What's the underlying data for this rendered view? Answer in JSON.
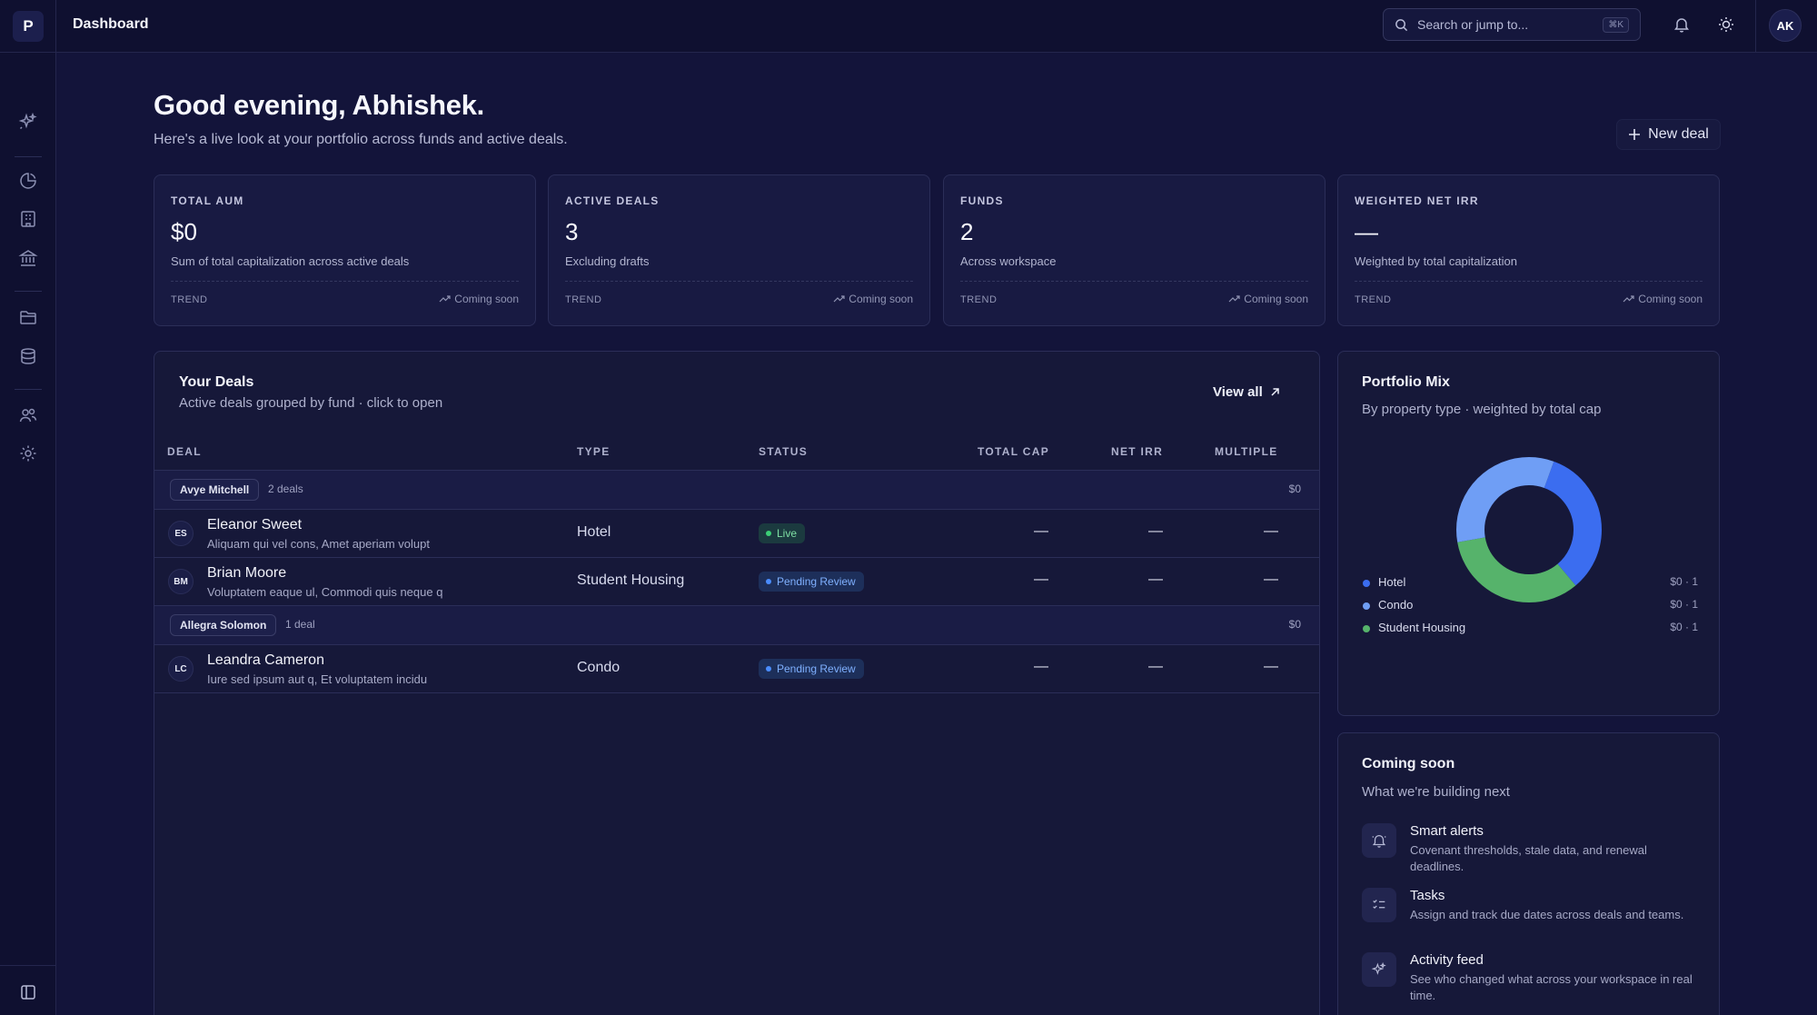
{
  "app": {
    "logo_letter": "P",
    "page_title": "Dashboard"
  },
  "search": {
    "placeholder": "Search or jump to...",
    "shortcut": "⌘K"
  },
  "user": {
    "initials": "AK"
  },
  "sidebar": {
    "icons": [
      "sparkle-icon",
      "pie-chart-icon",
      "building-icon",
      "bank-icon",
      "folder-icon",
      "database-icon",
      "users-icon",
      "gear-icon"
    ],
    "footer_icon": "sidebar-toggle-icon"
  },
  "header": {
    "greeting": "Good evening, Abhishek.",
    "subtitle": "Here's a live look at your portfolio across funds and active deals.",
    "new_deal_label": "New deal"
  },
  "kpis": [
    {
      "label": "TOTAL AUM",
      "value": "$0",
      "desc": "Sum of total capitalization across active deals",
      "trend_label": "TREND",
      "trend_value": "Coming soon"
    },
    {
      "label": "ACTIVE DEALS",
      "value": "3",
      "desc": "Excluding drafts",
      "trend_label": "TREND",
      "trend_value": "Coming soon"
    },
    {
      "label": "FUNDS",
      "value": "2",
      "desc": "Across workspace",
      "trend_label": "TREND",
      "trend_value": "Coming soon"
    },
    {
      "label": "WEIGHTED NET IRR",
      "value": "—",
      "desc": "Weighted by total capitalization",
      "trend_label": "TREND",
      "trend_value": "Coming soon"
    }
  ],
  "deals": {
    "title": "Your Deals",
    "subtitle": "Active deals grouped by fund · click to open",
    "view_all": "View all",
    "columns": [
      "DEAL",
      "TYPE",
      "STATUS",
      "TOTAL CAP",
      "NET IRR",
      "MULTIPLE"
    ],
    "groups": [
      {
        "fund": "Avye Mitchell",
        "count": "2 deals",
        "total": "$0",
        "rows": [
          {
            "initials": "ES",
            "name": "Eleanor Sweet",
            "desc": "Aliquam qui vel cons, Amet aperiam volupt",
            "type": "Hotel",
            "status": "Live",
            "total_cap": "—",
            "net_irr": "—",
            "multiple": "—"
          },
          {
            "initials": "BM",
            "name": "Brian Moore",
            "desc": "Voluptatem eaque ul, Commodi quis neque q",
            "type": "Student Housing",
            "status": "Pending Review",
            "total_cap": "—",
            "net_irr": "—",
            "multiple": "—"
          }
        ]
      },
      {
        "fund": "Allegra Solomon",
        "count": "1 deal",
        "total": "$0",
        "rows": [
          {
            "initials": "LC",
            "name": "Leandra Cameron",
            "desc": "Iure sed ipsum aut q, Et voluptatem incidu",
            "type": "Condo",
            "status": "Pending Review",
            "total_cap": "—",
            "net_irr": "—",
            "multiple": "—"
          }
        ]
      }
    ]
  },
  "portfolio_mix": {
    "title": "Portfolio Mix",
    "subtitle": "By property type · weighted by total cap",
    "legend": [
      {
        "name": "Hotel",
        "value": "$0 · 1",
        "color": "#3b6df0"
      },
      {
        "name": "Condo",
        "value": "$0 · 1",
        "color": "#6f9ef5"
      },
      {
        "name": "Student Housing",
        "value": "$0 · 1",
        "color": "#56b36b"
      }
    ]
  },
  "coming_soon": {
    "title": "Coming soon",
    "subtitle": "What we're building next",
    "features": [
      {
        "icon": "bell-icon",
        "name": "Smart alerts",
        "desc": "Covenant thresholds, stale data, and renewal deadlines."
      },
      {
        "icon": "checklist-icon",
        "name": "Tasks",
        "desc": "Assign and track due dates across deals and teams."
      },
      {
        "icon": "sparkle-icon",
        "name": "Activity feed",
        "desc": "See who changed what across your workspace in real time."
      }
    ]
  }
}
